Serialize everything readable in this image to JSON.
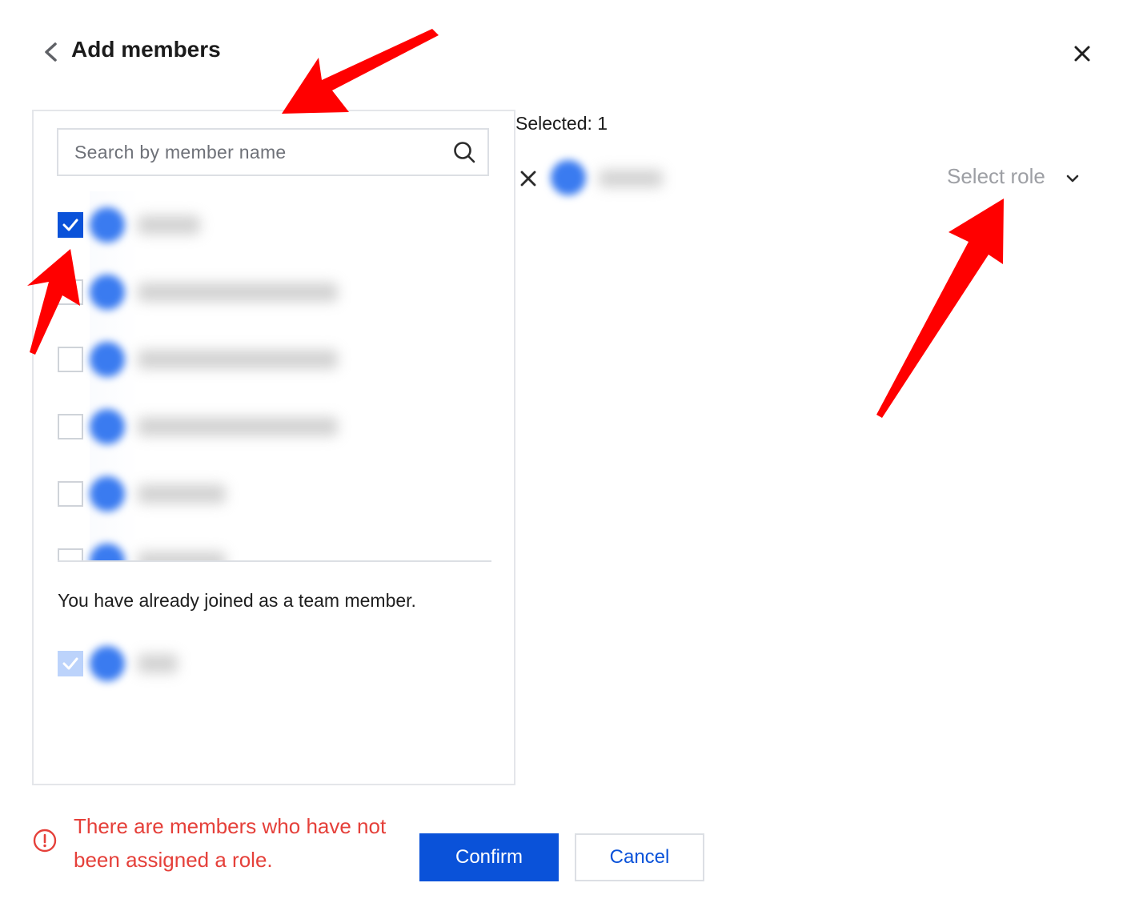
{
  "header": {
    "title": "Add members",
    "back_icon": "chevron-left-icon",
    "close_icon": "close-icon"
  },
  "search": {
    "placeholder": "Search by member name",
    "value": "",
    "icon": "search-icon"
  },
  "member_rows": [
    {
      "checked": true
    },
    {
      "checked": false
    },
    {
      "checked": false
    },
    {
      "checked": false
    },
    {
      "checked": false
    },
    {
      "checked": false
    }
  ],
  "joined_section": {
    "text": "You have already joined as a team member.",
    "checked": true,
    "disabled": true
  },
  "selected": {
    "count_label": "Selected: 1",
    "role_placeholder": "Select role"
  },
  "footer": {
    "warning_text": "There are members who have not been assigned a role.",
    "confirm_label": "Confirm",
    "cancel_label": "Cancel"
  },
  "colors": {
    "primary": "#0a52d9",
    "warning": "#e5403a",
    "annotation": "#ff0000"
  }
}
